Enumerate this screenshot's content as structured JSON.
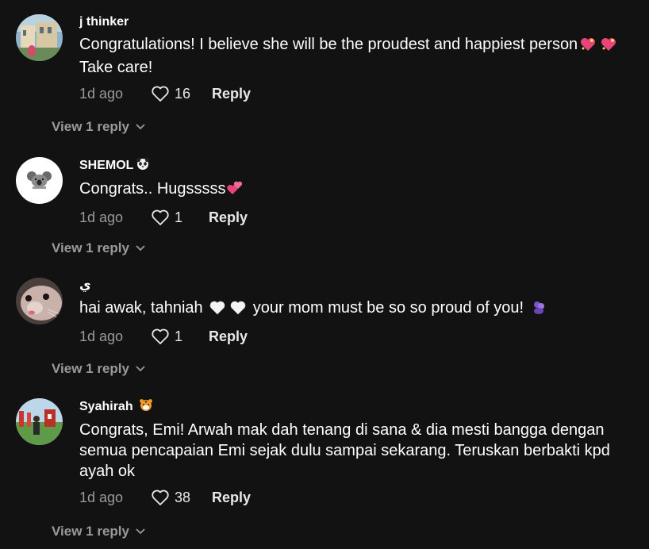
{
  "comments": [
    {
      "username": "j thinker",
      "text_before": "Congratulations! I believe she will be the proudest and happiest person",
      "text_after": "Take care!",
      "time": "1d ago",
      "likes": "16",
      "reply_label": "Reply",
      "view_replies": "View 1 reply",
      "emojis": [
        "sparkling-heart-emoji",
        "sparkling-heart-emoji"
      ]
    },
    {
      "username": "SHEMOL",
      "text_before": "Congrats.. Hugsssss",
      "text_after": "",
      "time": "1d ago",
      "likes": "1",
      "reply_label": "Reply",
      "view_replies": "View 1 reply",
      "username_emoji": "panda-face-emoji",
      "emojis": [
        "two-hearts-emoji"
      ]
    },
    {
      "username": "ي",
      "text_before": "hai awak, tahniah",
      "text_after": "your mom must be so so proud of you!",
      "time": "1d ago",
      "likes": "1",
      "reply_label": "Reply",
      "view_replies": "View 1 reply",
      "emojis": [
        "white-heart-emoji",
        "white-heart-emoji",
        "purple-hug-emoji"
      ]
    },
    {
      "username": "Syahirah",
      "text_before": "Congrats, Emi! Arwah mak dah tenang di sana & dia mesti bangga dengan semua pencapaian Emi sejak dulu sampai sekarang. Teruskan berbakti kpd ayah ok",
      "text_after": "",
      "time": "1d ago",
      "likes": "38",
      "reply_label": "Reply",
      "view_replies": "View 1 reply",
      "username_emoji": "tiger-face-emoji"
    }
  ],
  "colors": {
    "background": "#121212",
    "primary_text": "#ffffff",
    "secondary_text": "#9a9a9a"
  }
}
